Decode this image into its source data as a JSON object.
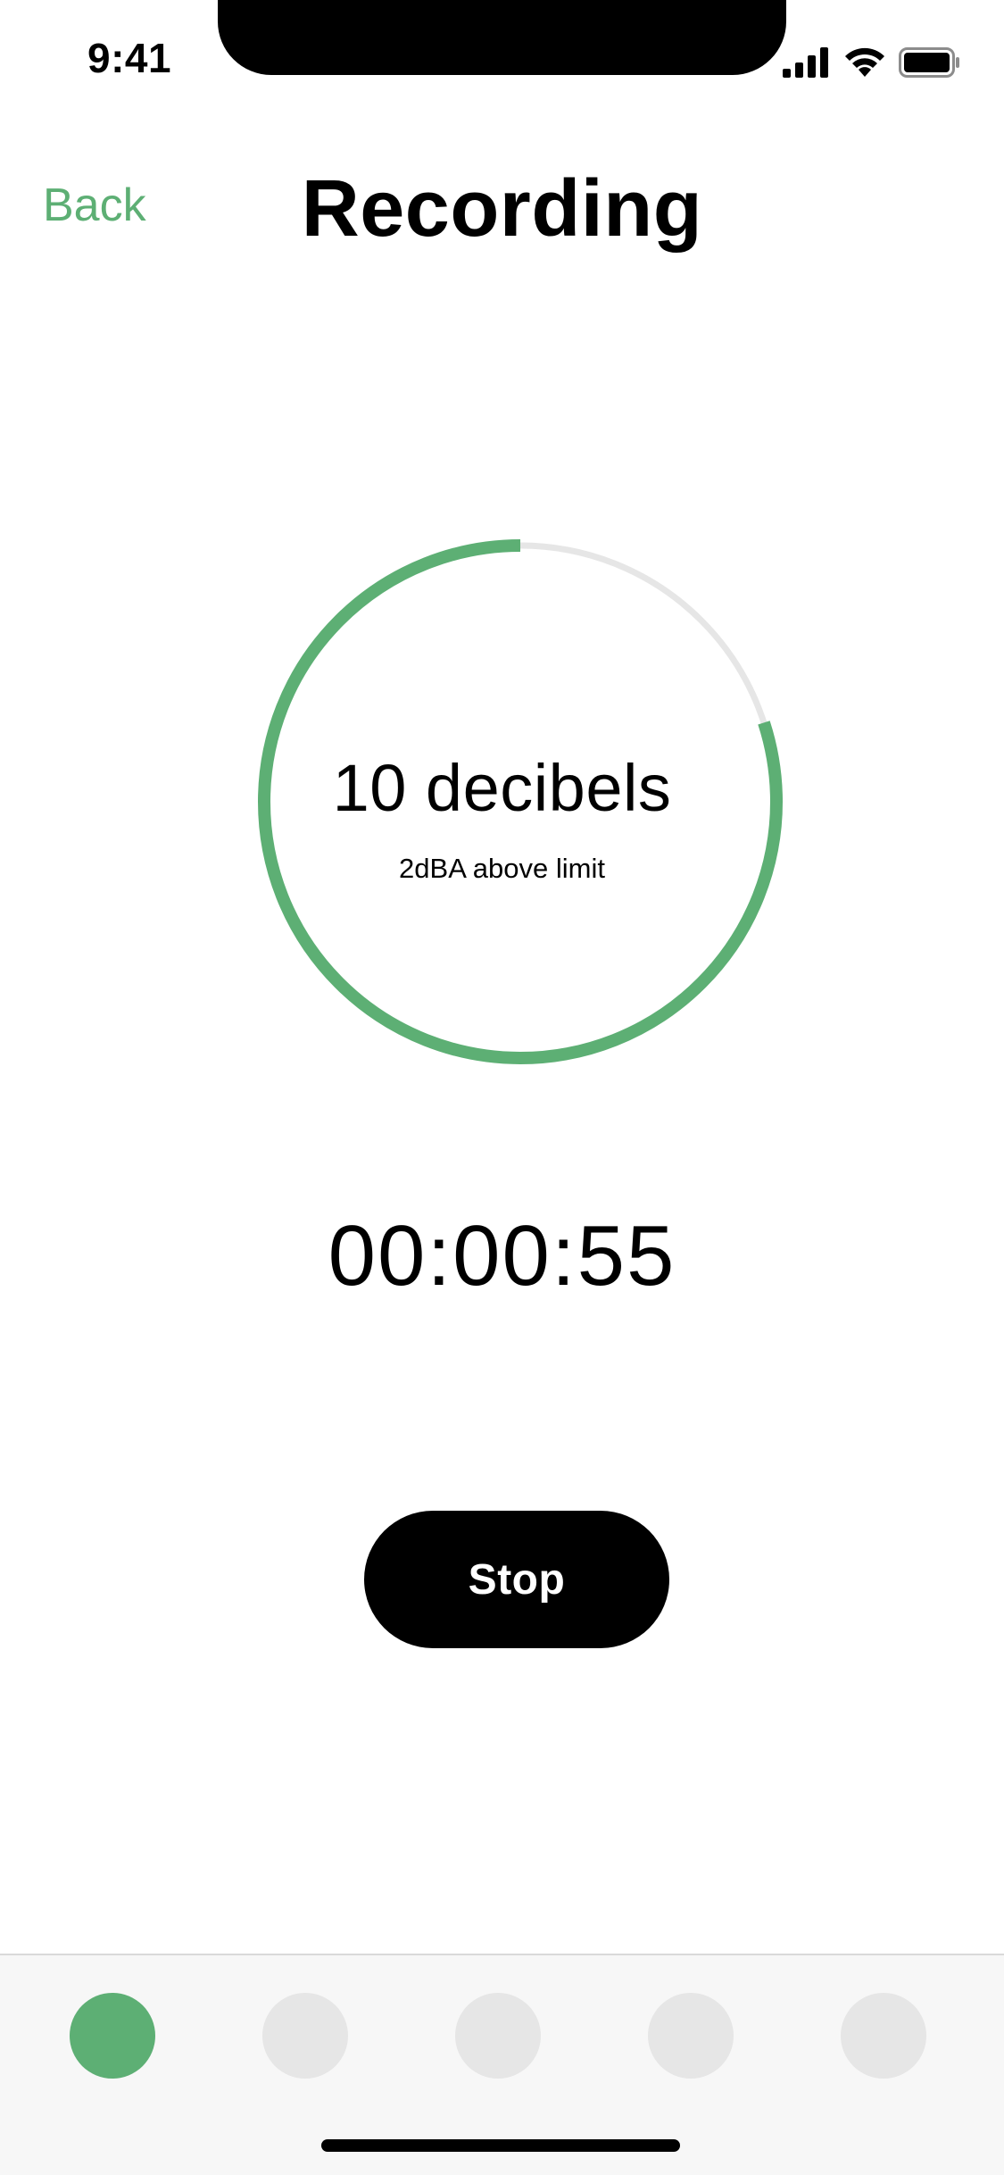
{
  "status_bar": {
    "time": "9:41"
  },
  "nav": {
    "back_label": "Back",
    "title": "Recording"
  },
  "meter": {
    "value_text": "10 decibels",
    "subtext": "2dBA above limit",
    "progress": 0.8,
    "progress_color": "#5daf74",
    "track_color": "#e6e6e6"
  },
  "timer": {
    "elapsed": "00:00:55"
  },
  "actions": {
    "stop_label": "Stop"
  },
  "tabs": [
    {
      "name": "tab-1",
      "active": true
    },
    {
      "name": "tab-2",
      "active": false
    },
    {
      "name": "tab-3",
      "active": false
    },
    {
      "name": "tab-4",
      "active": false
    },
    {
      "name": "tab-5",
      "active": false
    }
  ],
  "colors": {
    "accent": "#5daf74",
    "inactive_tab": "#e6e6e6",
    "tab_bar_bg": "#f7f7f7"
  }
}
